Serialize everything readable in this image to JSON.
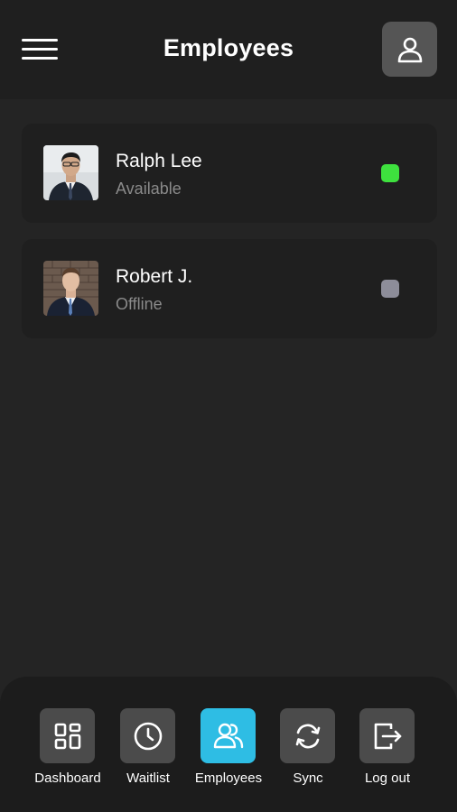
{
  "header": {
    "title": "Employees",
    "menu_icon": "hamburger-menu-icon",
    "profile_icon": "user-profile-icon"
  },
  "employees": [
    {
      "name": "Ralph Lee",
      "status": "Available",
      "status_color": "#3ee13e"
    },
    {
      "name": "Robert J.",
      "status": "Offline",
      "status_color": "#8d8d99"
    }
  ],
  "nav": {
    "items": [
      {
        "label": "Dashboard",
        "icon": "dashboard-grid-icon",
        "active": false
      },
      {
        "label": "Waitlist",
        "icon": "clock-icon",
        "active": false
      },
      {
        "label": "Employees",
        "icon": "employees-icon",
        "active": true
      },
      {
        "label": "Sync",
        "icon": "sync-icon",
        "active": false
      },
      {
        "label": "Log out",
        "icon": "logout-icon",
        "active": false
      }
    ]
  },
  "colors": {
    "background": "#242424",
    "surface": "#1f1f1f",
    "accent": "#2ebde4",
    "available": "#3ee13e",
    "offline": "#8d8d99"
  }
}
